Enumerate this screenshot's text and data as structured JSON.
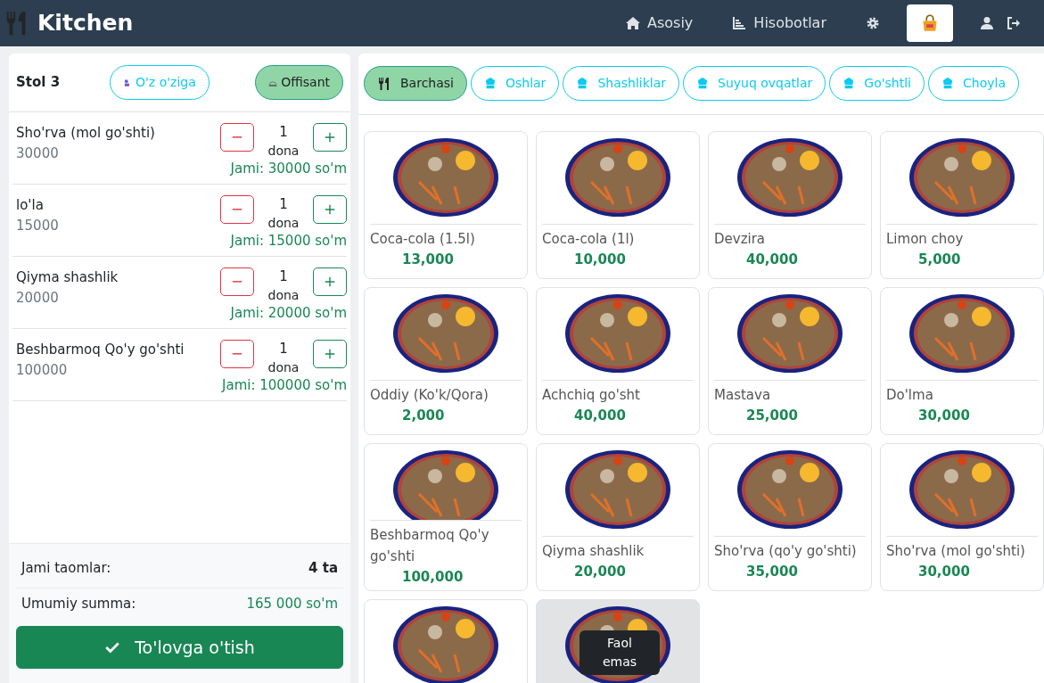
{
  "navbar": {
    "brand": "Kitchen",
    "links": [
      {
        "label": "Asosiy",
        "selected": false
      },
      {
        "label": "Hisobotlar",
        "selected": false
      },
      {
        "selected": false
      },
      {
        "selected": true
      },
      {
        "selected": false
      },
      {
        "selected": false
      }
    ]
  },
  "order": {
    "table": "Stol 3",
    "modes": [
      {
        "label": "O'z o'ziga",
        "selected": false
      },
      {
        "label": "Offisant",
        "selected": true
      }
    ],
    "items": [
      {
        "name": "Sho'rva (mol go'shti)",
        "price": "30000",
        "qty": "1",
        "unit": "dona",
        "total": "Jami: 30000 so'm"
      },
      {
        "name": "lo'la",
        "price": "15000",
        "qty": "1",
        "unit": "dona",
        "total": "Jami: 15000 so'm"
      },
      {
        "name": "Qiyma shashlik",
        "price": "20000",
        "qty": "1",
        "unit": "dona",
        "total": "Jami: 20000 so'm"
      },
      {
        "name": "Beshbarmoq Qo'y go'shti",
        "price": "100000",
        "qty": "1",
        "unit": "dona",
        "total": "Jami: 100000 so'm"
      }
    ],
    "count_label": "Jami taomlar:",
    "count": "4 ta",
    "sum_label": "Umumiy summa:",
    "sum": "165 000 so'm",
    "pay_button": "To'lovga o'tish"
  },
  "categories": [
    {
      "label": "Barchasi",
      "selected": true
    },
    {
      "label": "Oshlar",
      "selected": false
    },
    {
      "label": "Shashliklar",
      "selected": false
    },
    {
      "label": "Suyuq ovqatlar",
      "selected": false
    },
    {
      "label": "Go'shtli",
      "selected": false
    },
    {
      "label": "Choyla",
      "selected": false
    }
  ],
  "menu": [
    {
      "name": "Coca-cola (1.5l)",
      "price": "13,000",
      "active": true
    },
    {
      "name": "Coca-cola (1l)",
      "price": "10,000",
      "active": true
    },
    {
      "name": "Devzira",
      "price": "40,000",
      "active": true
    },
    {
      "name": "Limon choy",
      "price": "5,000",
      "active": true
    },
    {
      "name": "Oddiy (Ko'k/Qora)",
      "price": "2,000",
      "active": true
    },
    {
      "name": "Achchiq go'sht",
      "price": "40,000",
      "active": true
    },
    {
      "name": "Mastava",
      "price": "25,000",
      "active": true
    },
    {
      "name": "Do'lma",
      "price": "30,000",
      "active": true
    },
    {
      "name": "Beshbarmoq Qo'y go'shti",
      "price": "100,000",
      "active": true
    },
    {
      "name": "Qiyma shashlik",
      "price": "20,000",
      "active": true
    },
    {
      "name": "Sho'rva (qo'y go'shti)",
      "price": "35,000",
      "active": true
    },
    {
      "name": "Sho'rva (mol go'shti)",
      "price": "30,000",
      "active": true
    },
    {
      "active": true
    },
    {
      "active": false,
      "inactive_label": "Faol emas"
    }
  ]
}
